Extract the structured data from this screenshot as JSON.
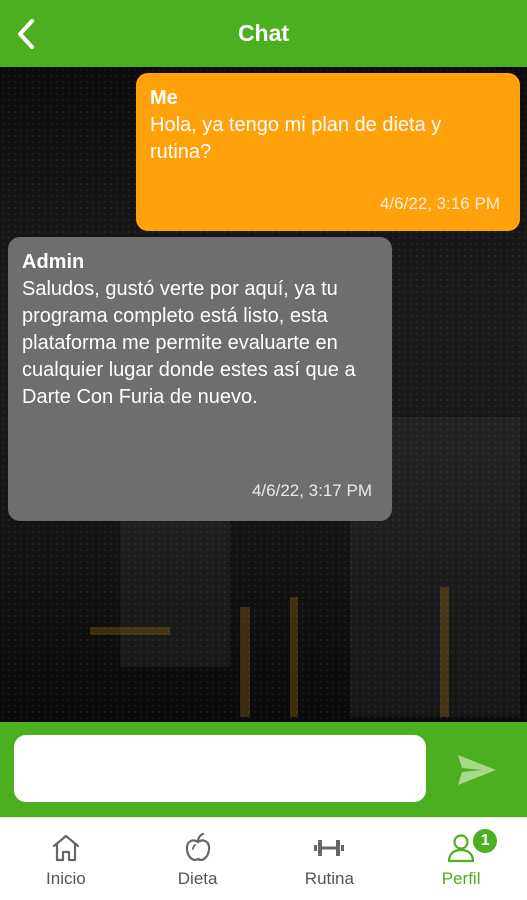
{
  "header": {
    "title": "Chat",
    "back_icon": "chevron-left-icon"
  },
  "messages": [
    {
      "sender": "Me",
      "text": "Hola, ya tengo mi plan de dieta y rutina?",
      "time": "4/6/22, 3:16 PM",
      "color": "#ffa10a"
    },
    {
      "sender": "Admin",
      "text": "Saludos, gustó verte por aquí, ya tu programa completo está listo, esta plataforma me permite evaluarte en cualquier lugar donde estes así que a Darte Con Furia de nuevo.",
      "time": "4/6/22, 3:17 PM",
      "color": "#6e6e6e"
    }
  ],
  "composer": {
    "value": "",
    "placeholder": "",
    "send_icon": "send-icon"
  },
  "tabs": [
    {
      "label": "Inicio",
      "icon": "home-icon"
    },
    {
      "label": "Dieta",
      "icon": "apple-icon"
    },
    {
      "label": "Rutina",
      "icon": "dumbbell-icon"
    },
    {
      "label": "Perfil",
      "icon": "user-icon",
      "badge": "1",
      "active": true
    }
  ],
  "colors": {
    "primary": "#4caf1f",
    "me_bubble": "#ffa10a",
    "admin_bubble": "#6e6e6e"
  }
}
